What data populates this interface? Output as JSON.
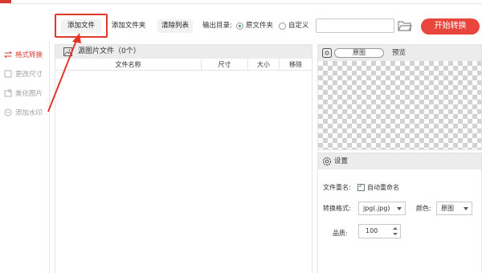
{
  "toolbar": {
    "add_file": "添加文件",
    "add_folder": "添加文件夹",
    "clear_list": "清除列表",
    "output_dir_label": "输出目录:",
    "option_original": "原文件夹",
    "option_custom": "自定义",
    "path_value": "",
    "start_button": "开始转换"
  },
  "sidebar": {
    "items": [
      {
        "label": "格式转换",
        "icon": "format-convert-icon",
        "active": true
      },
      {
        "label": "更改尺寸",
        "icon": "resize-icon",
        "active": false
      },
      {
        "label": "美化图片",
        "icon": "beautify-icon",
        "active": false
      },
      {
        "label": "添加水印",
        "icon": "watermark-icon",
        "active": false
      }
    ]
  },
  "file_panel": {
    "title": "源图片文件（0个）",
    "columns": [
      "文件名称",
      "尺寸",
      "大小",
      "移除"
    ]
  },
  "preview": {
    "mode_value": "原图",
    "label": "预览"
  },
  "settings": {
    "title": "设置",
    "rename_label": "文件重名:",
    "auto_rename": "自动重命名",
    "format_label": "转换格式:",
    "format_value": "jpg(.jpg)",
    "color_label": "颜色:",
    "color_value": "原图",
    "quality_label": "品质:",
    "quality_value": "100"
  },
  "colors": {
    "accent_red": "#e8453c",
    "radio_green": "#3aa55a",
    "highlight_box": "#e2372b"
  }
}
